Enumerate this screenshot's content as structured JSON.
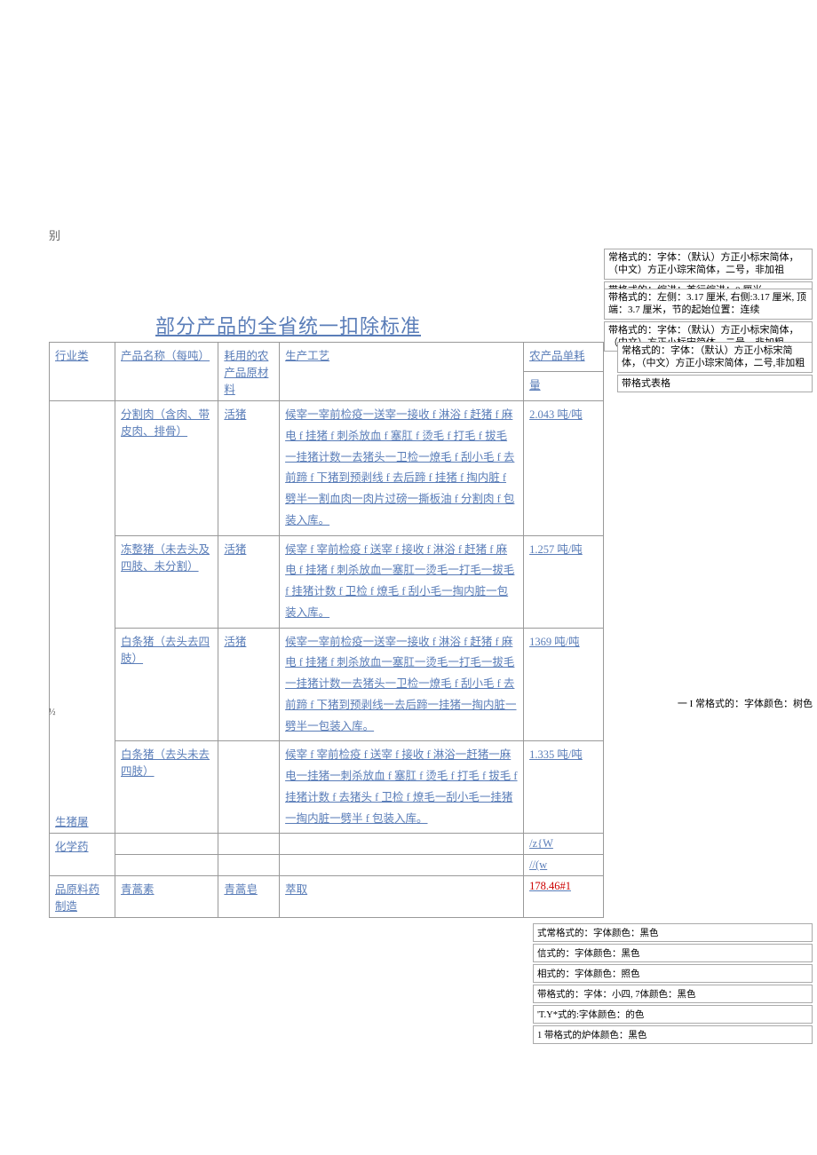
{
  "top_marker": "别",
  "title": "部分产品的全省统一扣除标准",
  "headers": {
    "col1": "行业类",
    "col2": "产品名称（每吨）",
    "col3": "耗用的农产品原材料",
    "col4": "生产工艺",
    "col5a": "农产品单耗",
    "col5b": "量"
  },
  "rows": [
    {
      "category": "生猪屠",
      "product": "分割肉（含肉、带皮肉、排骨）",
      "material": "活猪",
      "process": "候宰一宰前检疫一送宰一接收 f 淋浴 f 赶猪 f 麻电 f 挂猪 f 刺杀放血 f 塞肛 f 烫毛 f 打毛 f 拔毛一挂猪计数一去猪头一卫检一燎毛 f 刮小毛 f 去前蹄 f 下猪到预剥线 f 去后蹄 f 挂猪 f 掏内脏 f 劈半一割血肉一肉片过磅一撕板油 f 分割肉 f 包装入库。",
      "consumption": "2.043 吨/吨"
    },
    {
      "category": "",
      "product": "冻整猪（未去头及四肢、未分割）",
      "material": "活猪",
      "process": "候宰 f 宰前检疫 f 送宰 f 接收 f 淋浴 f 赶猪 f 麻电 f 挂猪 f 刺杀放血一塞肛一烫毛一打毛一拔毛 f 挂猪计数 f 卫检 f 燎毛 f 刮小毛一掏内脏一包装入库。",
      "consumption": "1.257 吨/吨"
    },
    {
      "category": "",
      "product": "白条猪（去头去四肢）",
      "material": "活猪",
      "process": "候宰一宰前检疫一送宰一接收 f 淋浴 f 赶猪 f 麻电 f 挂猪 f 刺杀放血一塞肛一烫毛一打毛一拔毛一挂猪计数一去猪头一卫检一燎毛 f 刮小毛 f 去前蹄 f 下猪到预剥线一去后蹄一挂猪一掏内脏一劈半一包装入库。",
      "consumption": "1369 吨/吨"
    },
    {
      "category": "",
      "product": "白条猪（去头未去四肢）",
      "material": "",
      "process": "候宰 f 宰前检疫 f 送宰 f 接收 f 淋浴一赶猪一麻电一挂猪一刺杀放血 f 塞肛 f 烫毛 f 打毛 f 拔毛 f 挂猪计数 f 去猪头 f 卫检 f 燎毛一刮小毛一挂猪一掏内脏一劈半 f 包装入库。",
      "consumption": "1.335 吨/吨"
    },
    {
      "category": "化学药",
      "product": "",
      "material": "",
      "process": "",
      "consumption_a": "/z{W",
      "consumption_b": "//(w"
    },
    {
      "category": "品原料药制造",
      "product": "青蒿素",
      "material": "青蒿皂",
      "process": "萃取",
      "consumption": "178.46#1"
    }
  ],
  "annotations": {
    "g1": [
      "常格式的：字体：（默认）方正小标宋简体，（中文）方正小琮宋简体，二号，非加祖",
      "带格式的：缩进：首行缩进：0 厘米"
    ],
    "g2": [
      "带格式的：左侧：3.17 厘米, 右侧:3.17 厘米, 顶端：3.7 厘米，节的起始位置：连续",
      "带格式的：字体：（默认）方正小标宋简体，（中文）方正小标宋简体，二号，非加粗"
    ],
    "g3": [
      "常格式的：字体：（默认）方正小标宋简体，（中文）方正小琮宋简体，二号,非加粗",
      "带格式表格"
    ],
    "g4": "一 I 常格式的：字体颜色：树色",
    "g5": [
      "式常格式的：字体颜色：黑色",
      "信式的：字体颜色：黑色",
      "相式的：字体颜色：照色",
      "带格式的：字体：小四, 7体颜色：黑色",
      "'T.Y*式的:字体颜色：的色",
      "1 带格式的炉体颜色：黑色"
    ]
  },
  "frac": "½"
}
